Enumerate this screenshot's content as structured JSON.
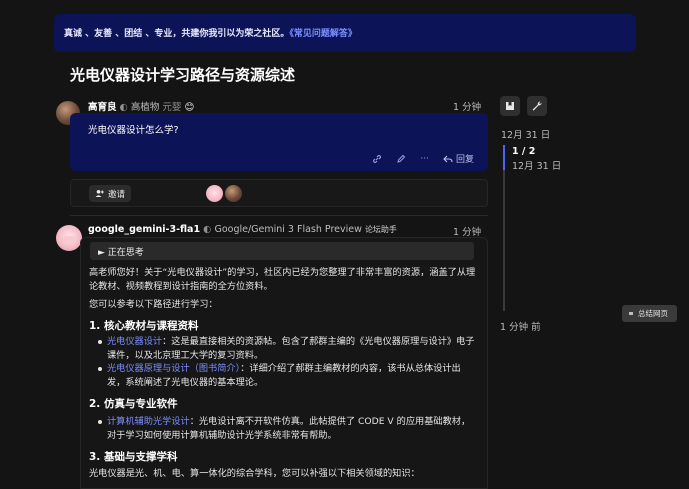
{
  "banner": {
    "text": "真诚 、友善 、团结 、专业，共建你我引以为荣之社区。",
    "link": "《常见问题解答》"
  },
  "topic": {
    "title": "光电仪器设计学习路径与资源综述"
  },
  "post1": {
    "username": "高育良",
    "fullname": "高植物",
    "status": "元婴",
    "status_emoji": "😊",
    "time": "1 分钟",
    "question": "光电仪器设计怎么学?",
    "reply_label": "回复",
    "more_label": "···",
    "avatar_badge": "🍑"
  },
  "invite": {
    "label": "邀请"
  },
  "post2": {
    "username": "google_gemini-3-fla1",
    "fullname": "Google/Gemini 3 Flash Preview",
    "tag": "论坛助手",
    "time": "1 分钟",
    "thinking": "正在思考",
    "intro": "高老师您好！关于“光电仪器设计”的学习，社区内已经为您整理了非常丰富的资源，涵盖了从理论教材、视频教程到设计指南的全方位资料。",
    "lead": "您可以参考以下路径进行学习：",
    "h1": "1. 核心教材与课程资料",
    "li1_link": "光电仪器设计",
    "li1_text": "：这是最直接相关的资源帖。包含了郝群主编的《光电仪器原理与设计》电子课件，以及北京理工大学的复习资料。",
    "li2_link": "光电仪器原理与设计（图书简介）",
    "li2_text": "：详细介绍了郝群主编教材的内容，该书从总体设计出发，系统阐述了光电仪器的基本理论。",
    "h2": "2. 仿真与专业软件",
    "li3_link": "计算机辅助光学设计",
    "li3_text": "：光电设计离不开软件仿真。此帖提供了 CODE V 的应用基础教材，对于学习如何使用计算机辅助设计光学系统非常有帮助。",
    "h3": "3. 基础与支撑学科",
    "tail": "光电仪器是光、机、电、算一体化的综合学科，您可以补强以下相关领域的知识："
  },
  "timeline": {
    "top_date": "12月 31 日",
    "count": "1 / 2",
    "sub_date": "12月 31 日",
    "bottom": "1 分钟 前"
  },
  "summary": {
    "label": "总结网页"
  }
}
